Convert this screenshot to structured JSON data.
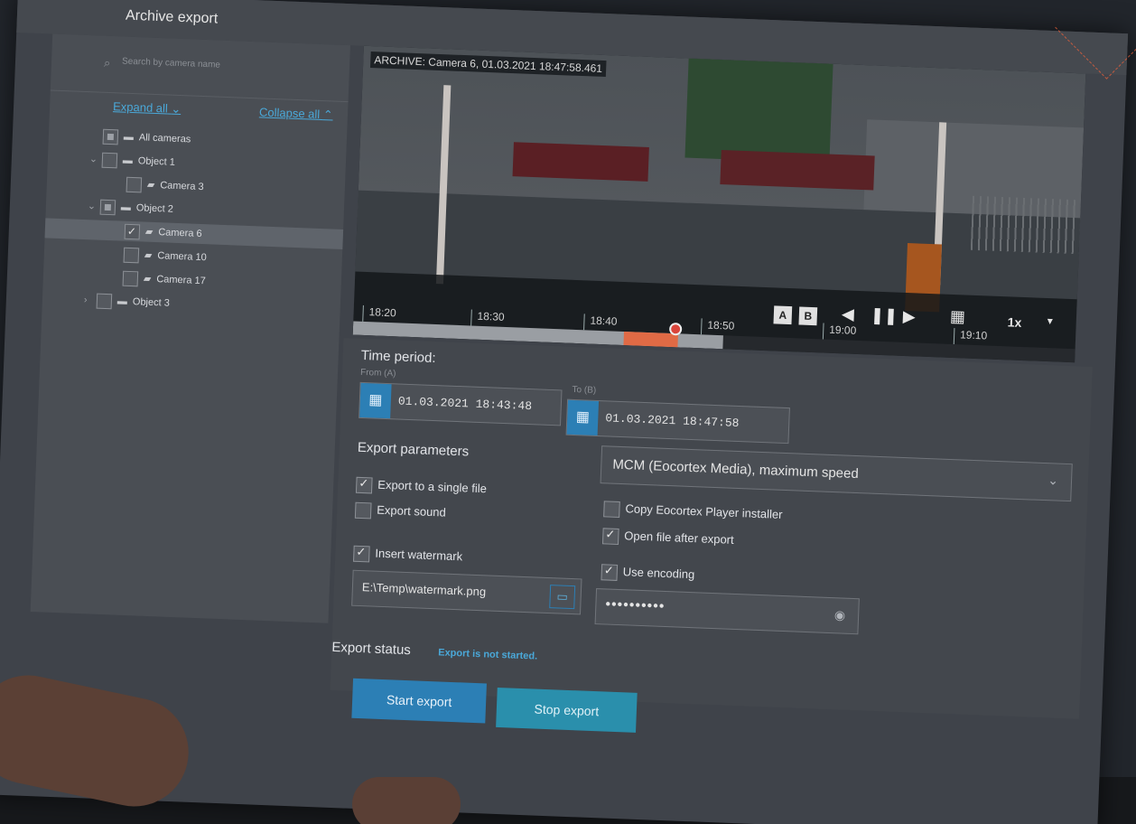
{
  "window": {
    "title": "Archive export"
  },
  "search": {
    "placeholder": "Search by camera name"
  },
  "tree_controls": {
    "expand_all": "Expand all",
    "collapse_all": "Collapse all"
  },
  "tree": [
    {
      "label": "All cameras",
      "type": "root",
      "state": "mixed"
    },
    {
      "label": "Object 1",
      "type": "folder",
      "state": "unchecked"
    },
    {
      "label": "Camera 3",
      "type": "camera",
      "state": "unchecked"
    },
    {
      "label": "Object 2",
      "type": "folder",
      "state": "mixed"
    },
    {
      "label": "Camera 6",
      "type": "camera",
      "state": "checked",
      "selected": true
    },
    {
      "label": "Camera 10",
      "type": "camera",
      "state": "unchecked"
    },
    {
      "label": "Camera 17",
      "type": "camera",
      "state": "unchecked"
    },
    {
      "label": "Object 3",
      "type": "folder",
      "state": "unchecked"
    }
  ],
  "video": {
    "overlay": "ARCHIVE: Camera 6, 01.03.2021 18:47:58.461",
    "speed": "1x",
    "ticks": [
      "18:20",
      "18:30",
      "18:40",
      "18:50",
      "19:00",
      "19:10"
    ],
    "marker_a": "A",
    "marker_b": "B"
  },
  "time_period": {
    "title": "Time period:",
    "from_label": "From (A)",
    "from_value": "01.03.2021  18:43:48",
    "to_label": "To (B)",
    "to_value": "01.03.2021  18:47:58"
  },
  "export_params": {
    "title": "Export parameters",
    "format": "MCM (Eocortex Media), maximum speed",
    "single_file": "Export to a single file",
    "sound": "Export sound",
    "copy_player": "Copy Eocortex Player installer",
    "open_after": "Open file after export",
    "watermark": "Insert watermark",
    "watermark_path": "E:\\Temp\\watermark.png",
    "encoding": "Use encoding",
    "password": "••••••••••"
  },
  "status": {
    "label": "Export status",
    "value": "Export is not started."
  },
  "buttons": {
    "start": "Start export",
    "stop": "Stop export"
  },
  "colors": {
    "accent": "#f4623a",
    "primary": "#2c7fb5",
    "link": "#4aa8d8"
  }
}
